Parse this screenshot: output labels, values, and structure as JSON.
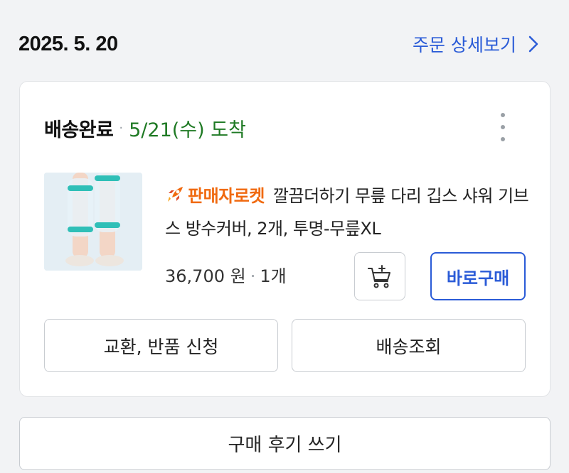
{
  "header": {
    "order_date": "2025. 5. 20",
    "detail_link": "주문 상세보기"
  },
  "order": {
    "status": "배송완료",
    "arrival": "5/21(수) 도착",
    "product": {
      "seller_badge": "판매자로켓",
      "name": "깔끔더하기 무릎 다리 깁스 샤워 기브스 방수커버, 2개, 투명-무릎XL",
      "price": "36,700 원",
      "quantity": "1개"
    },
    "buttons": {
      "buy_now": "바로구매",
      "exchange_return": "교환, 반품 신청",
      "track_delivery": "배송조회"
    }
  },
  "review_button": "구매 후기 쓰기",
  "colors": {
    "accent_blue": "#2a5bd7",
    "arrival_green": "#1f7a24",
    "seller_orange": "#f06a10"
  },
  "icons": {
    "more": "more-vertical-icon",
    "cart": "add-to-cart-icon",
    "rocket": "rocket-icon",
    "chevron": "chevron-right-icon"
  }
}
